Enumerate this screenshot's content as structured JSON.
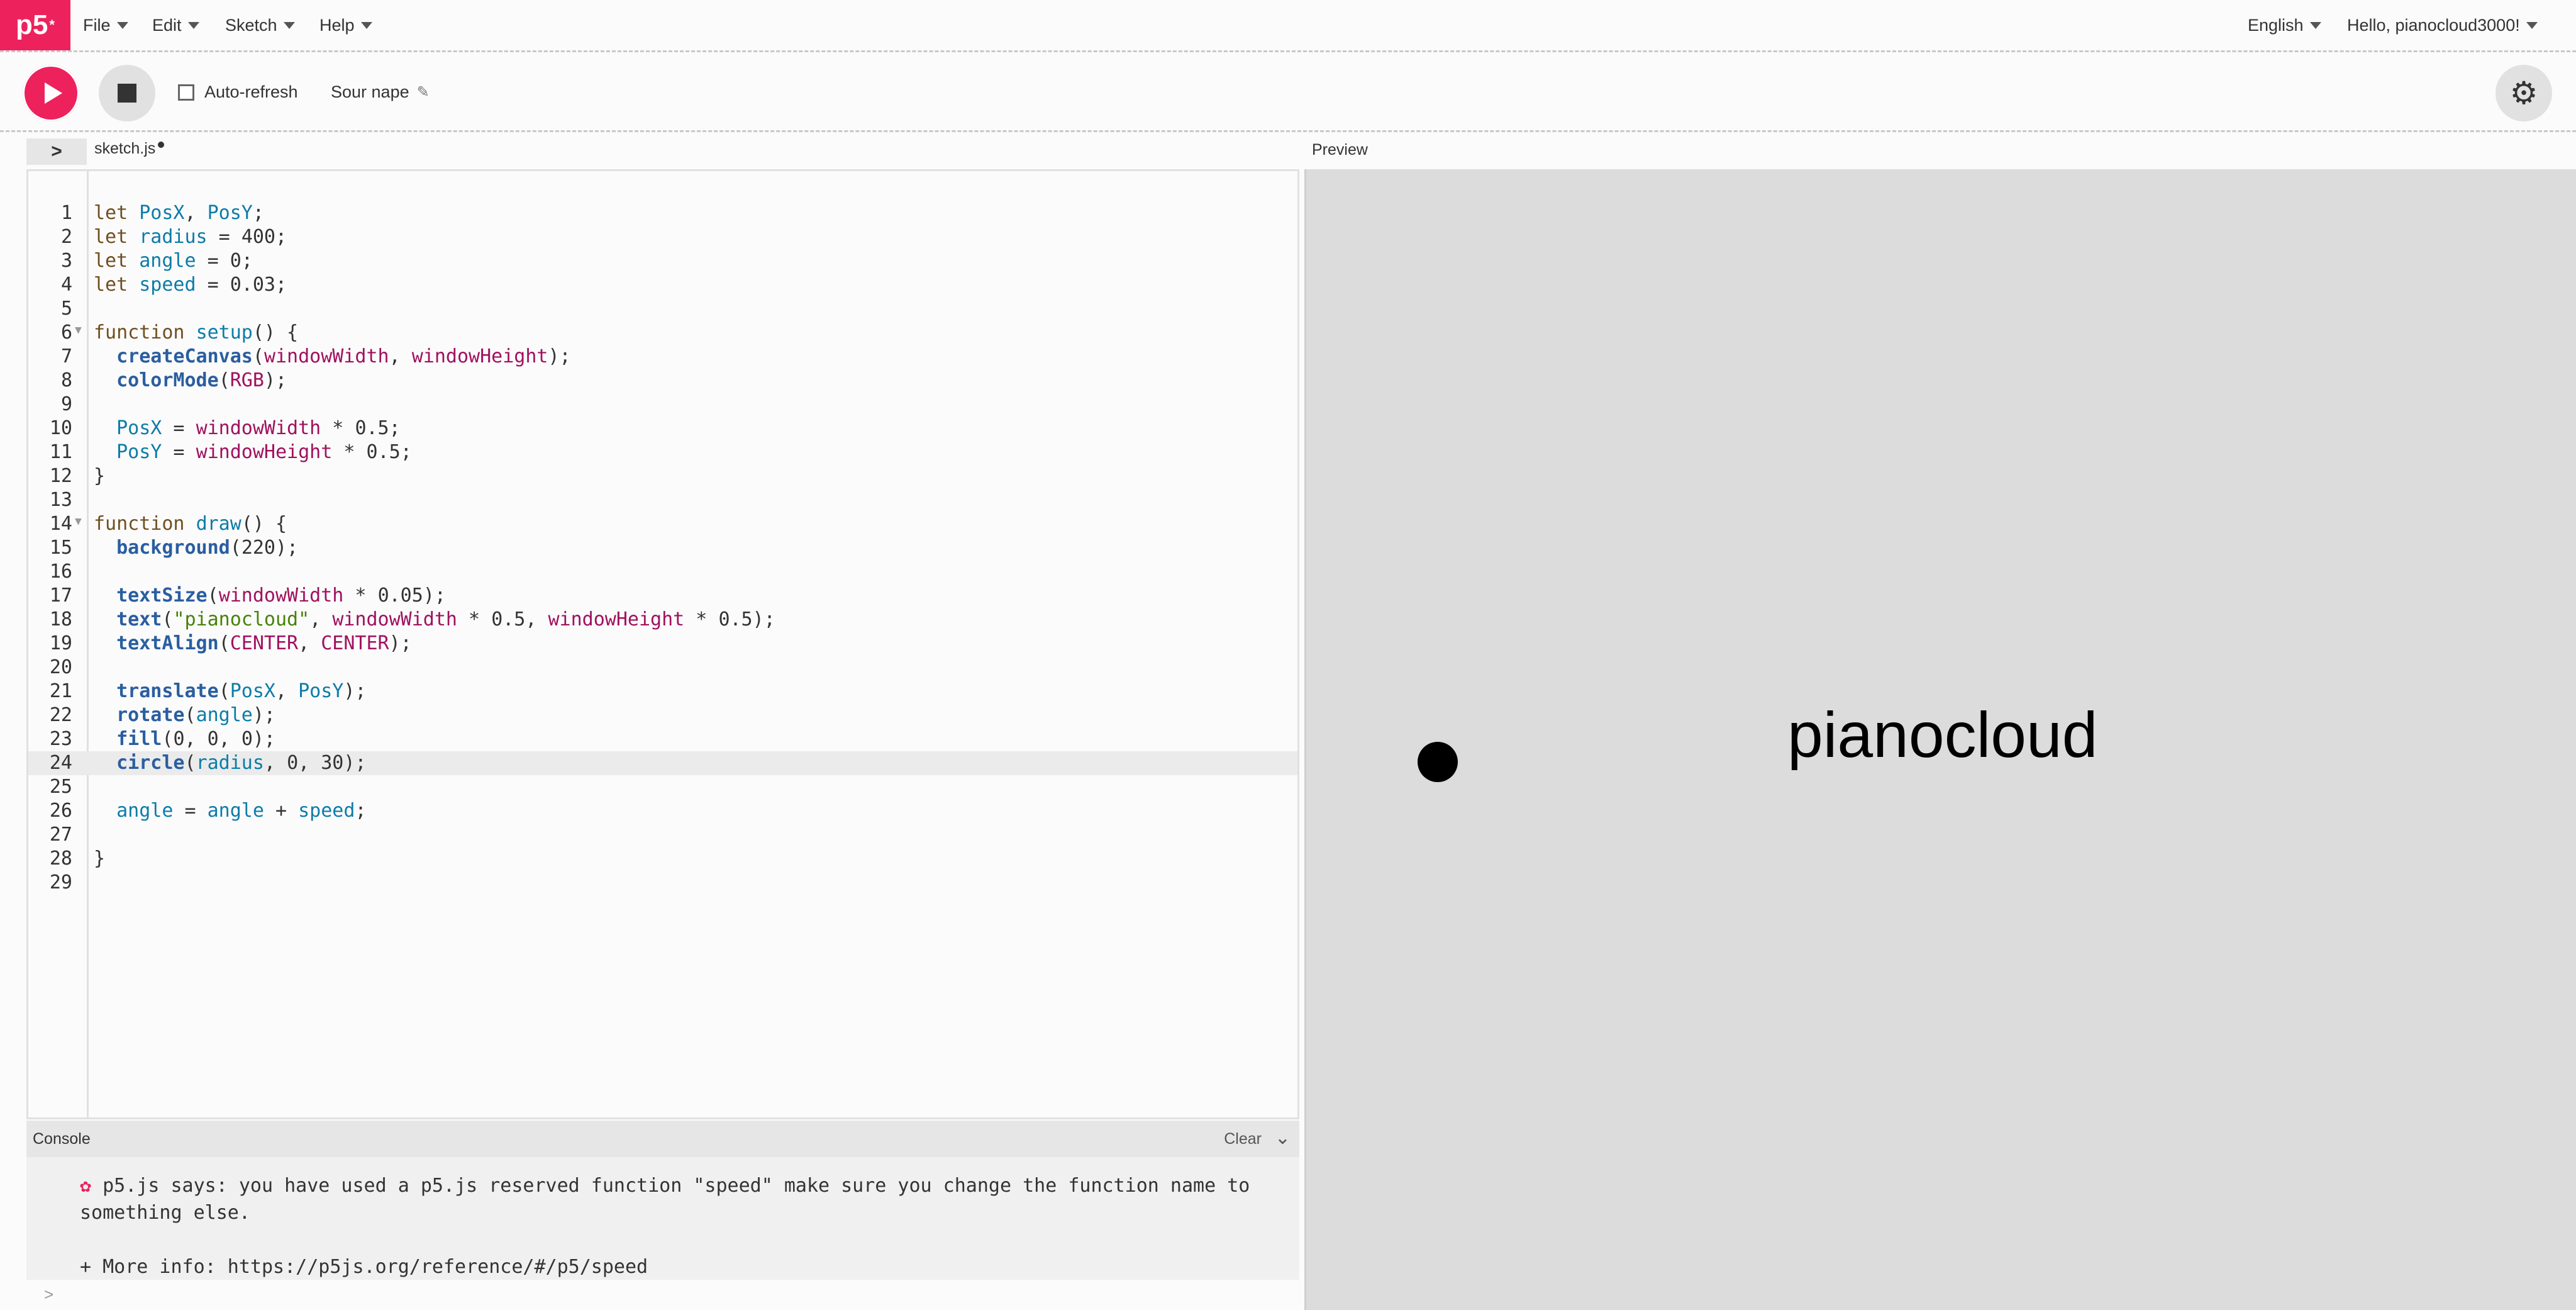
{
  "nav": {
    "logo": "p5",
    "logo_sup": "*",
    "menus": [
      "File",
      "Edit",
      "Sketch",
      "Help"
    ],
    "language": "English",
    "user": "Hello, pianocloud3000!"
  },
  "toolbar": {
    "auto_refresh_label": "Auto-refresh",
    "sketch_name": "Sour nape",
    "icons": [
      "play-icon",
      "stop-icon",
      "pencil-icon",
      "gear-icon"
    ]
  },
  "editor": {
    "file_name": "sketch.js",
    "active_line": 24,
    "lines": [
      {
        "n": "1",
        "t": "let PosX, PosY;"
      },
      {
        "n": "2",
        "t": "let radius = 400;"
      },
      {
        "n": "3",
        "t": "let angle = 0;"
      },
      {
        "n": "4",
        "t": "let speed = 0.03;"
      },
      {
        "n": "5",
        "t": ""
      },
      {
        "n": "6",
        "t": "function setup() {"
      },
      {
        "n": "7",
        "t": "  createCanvas(windowWidth, windowHeight);"
      },
      {
        "n": "8",
        "t": "  colorMode(RGB);"
      },
      {
        "n": "9",
        "t": ""
      },
      {
        "n": "10",
        "t": "  PosX = windowWidth * 0.5;"
      },
      {
        "n": "11",
        "t": "  PosY = windowHeight * 0.5;"
      },
      {
        "n": "12",
        "t": "}"
      },
      {
        "n": "13",
        "t": ""
      },
      {
        "n": "14",
        "t": "function draw() {"
      },
      {
        "n": "15",
        "t": "  background(220);"
      },
      {
        "n": "16",
        "t": ""
      },
      {
        "n": "17",
        "t": "  textSize(windowWidth * 0.05);"
      },
      {
        "n": "18",
        "t": "  text(\"pianocloud\", windowWidth * 0.5, windowHeight * 0.5);"
      },
      {
        "n": "19",
        "t": "  textAlign(CENTER, CENTER);"
      },
      {
        "n": "20",
        "t": ""
      },
      {
        "n": "21",
        "t": "  translate(PosX, PosY);"
      },
      {
        "n": "22",
        "t": "  rotate(angle);"
      },
      {
        "n": "23",
        "t": "  fill(0, 0, 0);"
      },
      {
        "n": "24",
        "t": "  circle(radius, 0, 30);"
      },
      {
        "n": "25",
        "t": ""
      },
      {
        "n": "26",
        "t": "  angle = angle + speed;"
      },
      {
        "n": "27",
        "t": ""
      },
      {
        "n": "28",
        "t": "}"
      },
      {
        "n": "29",
        "t": ""
      }
    ]
  },
  "console": {
    "title": "Console",
    "clear_label": "Clear",
    "message": "p5.js says: you have used a p5.js reserved function \"speed\" make sure you change the function name to something else.",
    "more_info": "+ More info: https://p5js.org/reference/#/p5/speed",
    "prompt": ">"
  },
  "preview": {
    "label": "Preview",
    "canvas_text": "pianocloud"
  }
}
